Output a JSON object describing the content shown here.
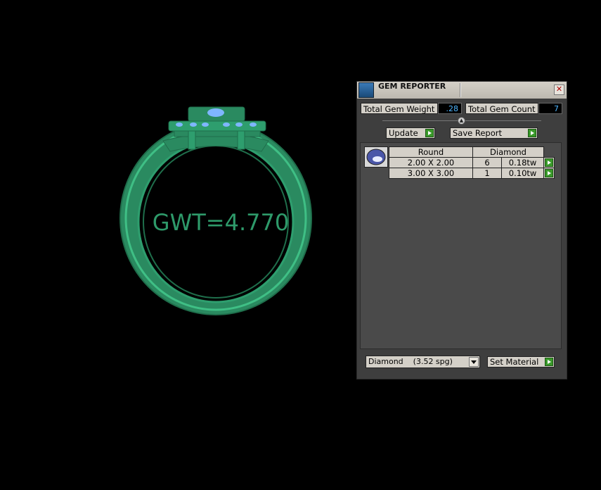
{
  "viewport": {
    "annotation": "GWT=4.770",
    "colors": {
      "metal": "#2e9e6e",
      "metal_edge": "#1f6e4b",
      "gem": "#7fb6ff",
      "text": "#2e9a6a"
    }
  },
  "panel": {
    "title": "GEM REPORTER",
    "close_glyph": "✕",
    "total_gem_weight_label": "Total Gem Weight",
    "total_gem_weight_value": ".28",
    "total_gem_count_label": "Total Gem Count",
    "total_gem_count_value": "7",
    "splitter_glyph": "▲",
    "update_label": "Update",
    "save_report_label": "Save Report",
    "table": {
      "headers": [
        "Round",
        "Diamond"
      ],
      "rows": [
        {
          "size": "2.00 X 2.00",
          "count": "6",
          "weight": "0.18tw"
        },
        {
          "size": "3.00 X 3.00",
          "count": "1",
          "weight": "0.10tw"
        }
      ]
    },
    "material_select": "Diamond    (3.52 spg)",
    "set_material_label": "Set Material",
    "colors": {
      "value_text": "#4fb6ff",
      "go_button": "#3a9a2a"
    }
  }
}
